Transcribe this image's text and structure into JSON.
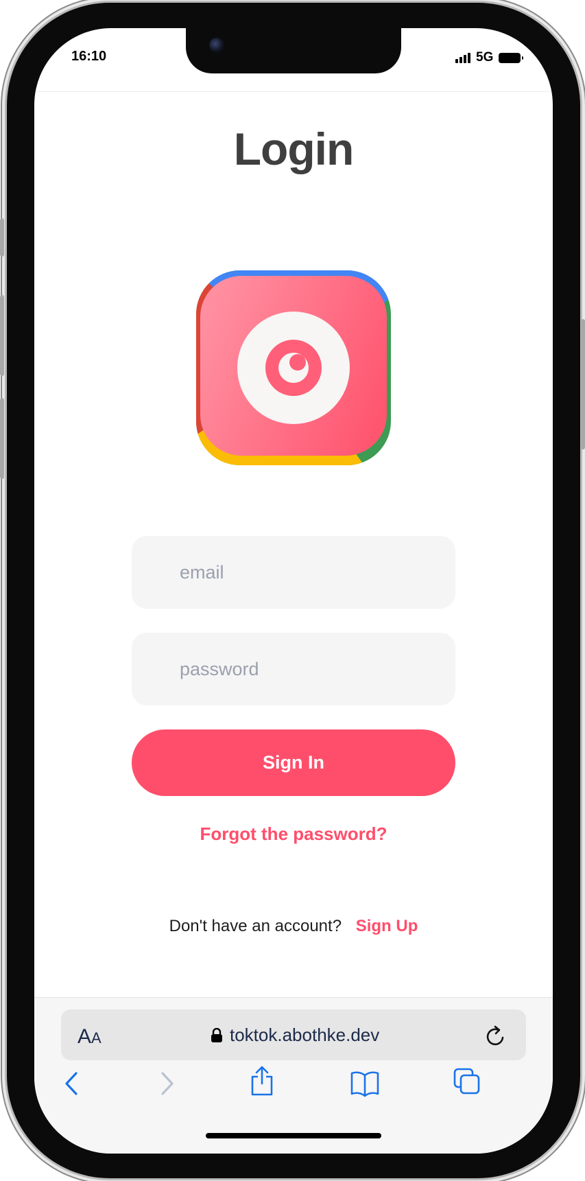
{
  "status_bar": {
    "time": "16:10",
    "network": "5G"
  },
  "page": {
    "title": "Login"
  },
  "login_form": {
    "email_placeholder": "email",
    "password_placeholder": "password",
    "sign_in_label": "Sign In",
    "forgot_password_label": "Forgot the password?",
    "signup_prompt": "Don't have an account?",
    "signup_link": "Sign Up"
  },
  "browser": {
    "text_size_label_big": "A",
    "text_size_label_small": "A",
    "url": "toktok.abothke.dev"
  },
  "icons": {
    "app_logo": "eye-camera-logo-icon",
    "lock": "lock-icon",
    "reload": "reload-icon",
    "back": "chevron-left-icon",
    "forward": "chevron-right-icon",
    "share": "share-icon",
    "bookmarks": "book-icon",
    "tabs": "tabs-icon"
  },
  "colors": {
    "accent": "#ff4e6b",
    "title_text": "#3f3f3f",
    "input_background": "#f5f5f5",
    "browser_blue": "#1a73e8"
  }
}
